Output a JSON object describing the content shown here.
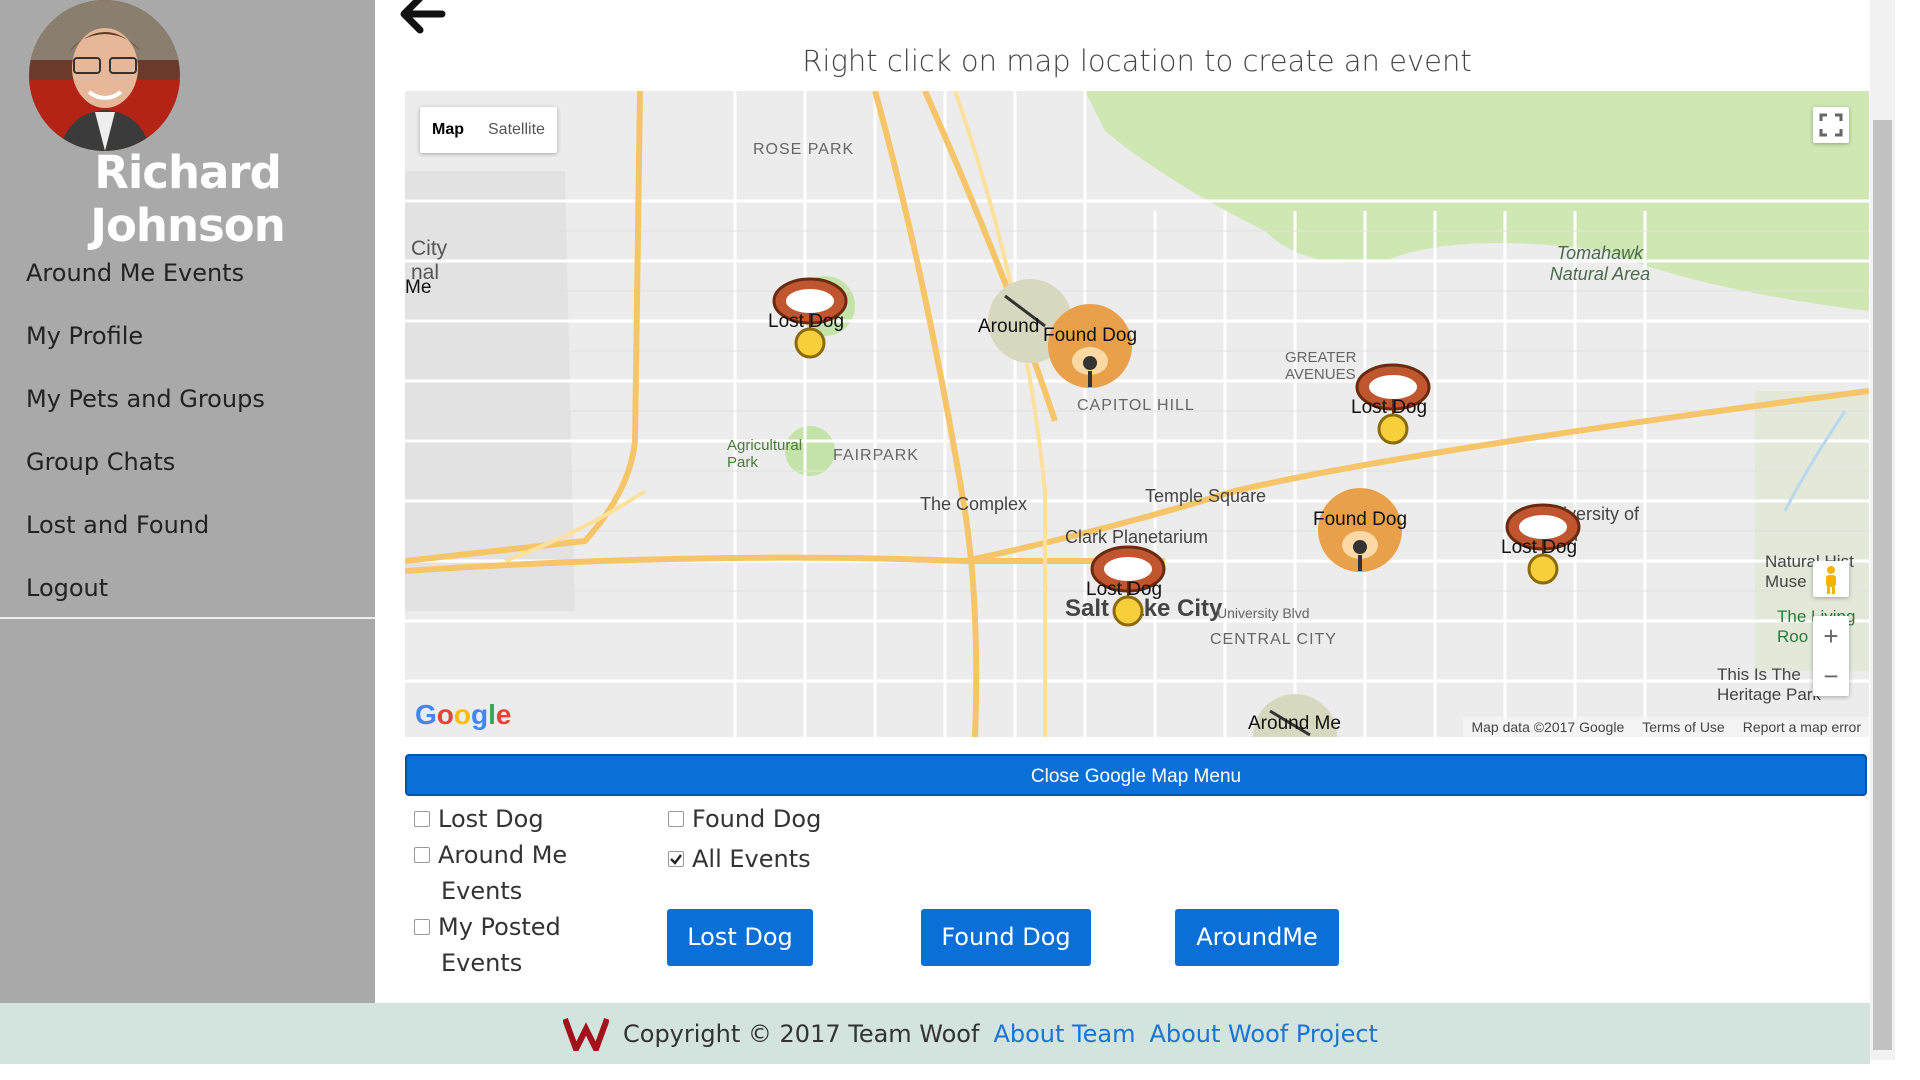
{
  "user": {
    "name": "Richard Johnson"
  },
  "nav": {
    "items": [
      {
        "label": "Around Me Events"
      },
      {
        "label": "My Profile"
      },
      {
        "label": "My Pets and Groups"
      },
      {
        "label": "Group Chats"
      },
      {
        "label": "Lost and Found"
      },
      {
        "label": "Logout"
      }
    ]
  },
  "main": {
    "instruction": "Right click on map location to create an event"
  },
  "map": {
    "type_options": {
      "map": "Map",
      "satellite": "Satellite"
    },
    "zoom_in": "+",
    "zoom_out": "−",
    "logo": "Google",
    "attribution": {
      "data": "Map data ©2017 Google",
      "terms": "Terms of Use",
      "report": "Report a map error"
    },
    "markers": [
      {
        "label": "Lost Dog"
      },
      {
        "label": "Around"
      },
      {
        "label": "Found Dog"
      },
      {
        "label": "Lost Dog"
      },
      {
        "label": "Found Dog"
      },
      {
        "label": "Lost Dog"
      },
      {
        "label": "Lost Dog"
      },
      {
        "label": "Around Me"
      },
      {
        "label": "Me"
      }
    ],
    "places": {
      "rose_park": "ROSE PARK",
      "capitol_hill": "CAPITOL HILL",
      "fairpark": "FAIRPARK",
      "agricultural_park": "Agricultural Park",
      "greater_avenues": "GREATER AVENUES",
      "tomahawk": "Tomahawk Natural Area",
      "the_complex": "The Complex",
      "temple_square": "Temple Square",
      "clark_planetarium": "Clark Planetarium",
      "salt_lake_city": "Salt Lake City",
      "central_city": "CENTRAL CITY",
      "university": "University of Utah",
      "natural_history": "Natural Hist Muse",
      "living_room": "The Living Roo",
      "heritage": "This Is The Heritage Park",
      "city_nal": "City nal",
      "university_blvd": "University Blvd"
    }
  },
  "close_menu": {
    "label": "Close Google Map Menu"
  },
  "filters": {
    "lost_dog": "Lost Dog",
    "found_dog": "Found Dog",
    "around_me_line1": "Around Me",
    "around_me_line2": "Events",
    "all_events": "All Events",
    "my_posted_line1": "My Posted",
    "my_posted_line2": "Events",
    "all_events_checked": true
  },
  "actions": {
    "lost_dog": "Lost Dog",
    "found_dog": "Found Dog",
    "around_me": "AroundMe"
  },
  "footer": {
    "copyright": "Copyright © 2017 Team Woof",
    "about_team": "About Team",
    "about_project": "About Woof Project"
  },
  "colors": {
    "sidebar": "#a9a9a9",
    "primary_button": "#0a6fd6",
    "footer": "#d3e3dd",
    "link": "#1a73d6",
    "logo_red": "#a3121c"
  }
}
